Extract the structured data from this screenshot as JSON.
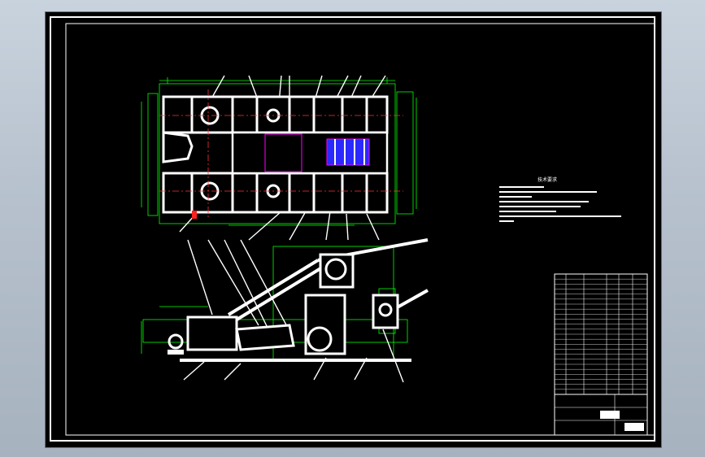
{
  "drawing": {
    "notes_title": "技术要求",
    "notes_lines": [
      "",
      "",
      "",
      "",
      "",
      "",
      "",
      ""
    ],
    "bom_rows": 24,
    "title_block_rows": 3
  },
  "colors": {
    "background": "#000000",
    "outline": "#ffffff",
    "dimension": "#00ff00",
    "centerline": "#ff3030",
    "hidden": "#ff00ff",
    "highlight_fill": "#2a2aff",
    "marker": "#ff2020"
  }
}
